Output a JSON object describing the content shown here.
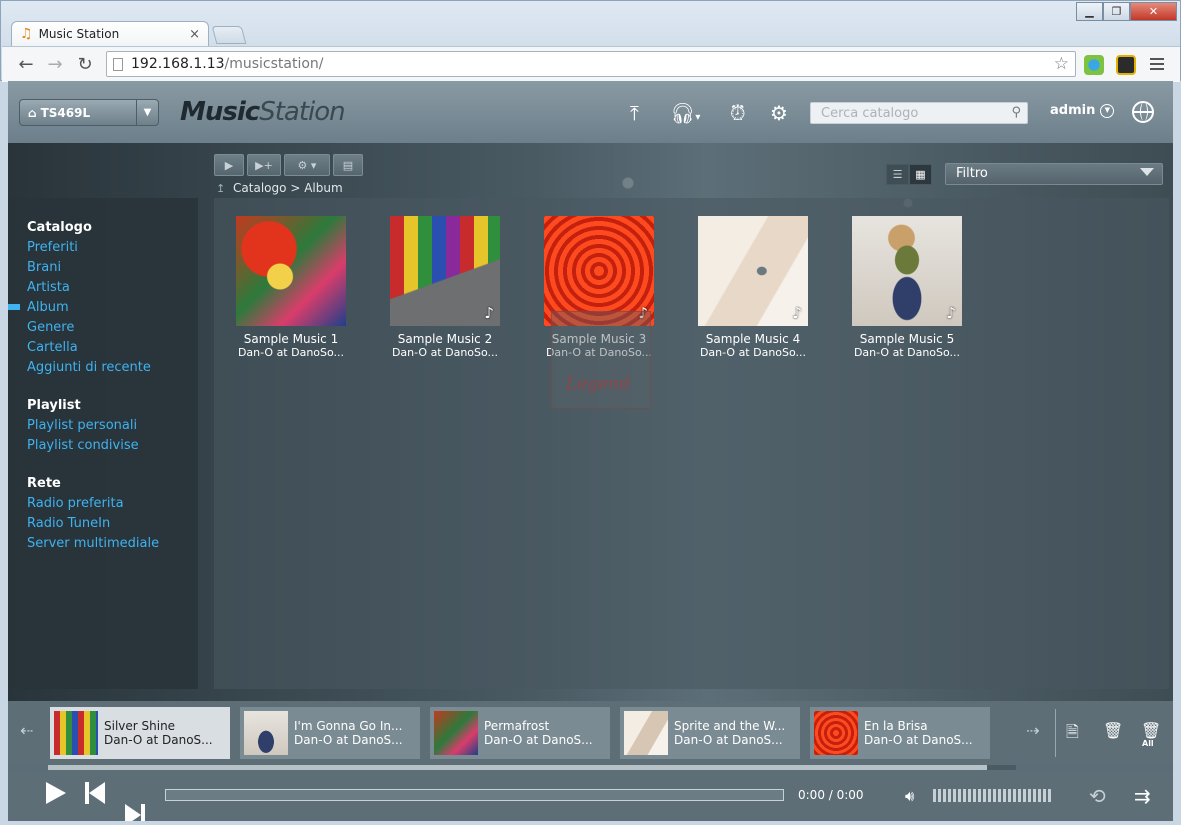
{
  "browser": {
    "tab_title": "Music Station",
    "tab_close": "×",
    "url_host": "192.168.1.13",
    "url_path": "/musicstation/",
    "window_controls": [
      "▁",
      "❐",
      "✕"
    ]
  },
  "header": {
    "nas_name": "TS469L",
    "logo_bold": "Music",
    "logo_light": "Station",
    "search_placeholder": "Cerca catalogo",
    "user": "admin"
  },
  "toolbar": {
    "breadcrumb_root": "Catalogo",
    "breadcrumb_sep": ">",
    "breadcrumb_current": "Album",
    "filter_label": "Filtro"
  },
  "sidebar": {
    "groups": [
      {
        "header": "Catalogo",
        "items": [
          "Preferiti",
          "Brani",
          "Artista",
          "Album",
          "Genere",
          "Cartella",
          "Aggiunti di recente"
        ]
      },
      {
        "header": "Playlist",
        "items": [
          "Playlist personali",
          "Playlist condivise"
        ]
      },
      {
        "header": "Rete",
        "items": [
          "Radio preferita",
          "Radio TuneIn",
          "Server multimediale"
        ]
      }
    ],
    "active_item": "Album"
  },
  "albums": [
    {
      "title": "Sample Music 1",
      "artist": "Dan-O at DanoSo..."
    },
    {
      "title": "Sample Music 2",
      "artist": "Dan-O at DanoSo..."
    },
    {
      "title": "Sample Music 3",
      "artist": "Dan-O at DanoSo..."
    },
    {
      "title": "Sample Music 4",
      "artist": "Dan-O at DanoSo..."
    },
    {
      "title": "Sample Music 5",
      "artist": "Dan-O at DanoSo..."
    }
  ],
  "watermark_text": "Legend",
  "queue": [
    {
      "title": "Silver Shine",
      "artist": "Dan-O at DanoS..."
    },
    {
      "title": "I'm Gonna Go In...",
      "artist": "Dan-O at DanoS..."
    },
    {
      "title": "Permafrost",
      "artist": "Dan-O at DanoS..."
    },
    {
      "title": "Sprite and the W...",
      "artist": "Dan-O at DanoS..."
    },
    {
      "title": "En la Brisa",
      "artist": "Dan-O at DanoS..."
    }
  ],
  "queue_tools": {
    "delete_all_label": "All"
  },
  "player": {
    "time": "0:00 / 0:00",
    "progress": 0.0,
    "volume_level": 0.0,
    "queue_scroll_fraction": 0.97
  },
  "colors": {
    "accent": "#3fb2f0",
    "sidebar_bg": "#28343a"
  }
}
